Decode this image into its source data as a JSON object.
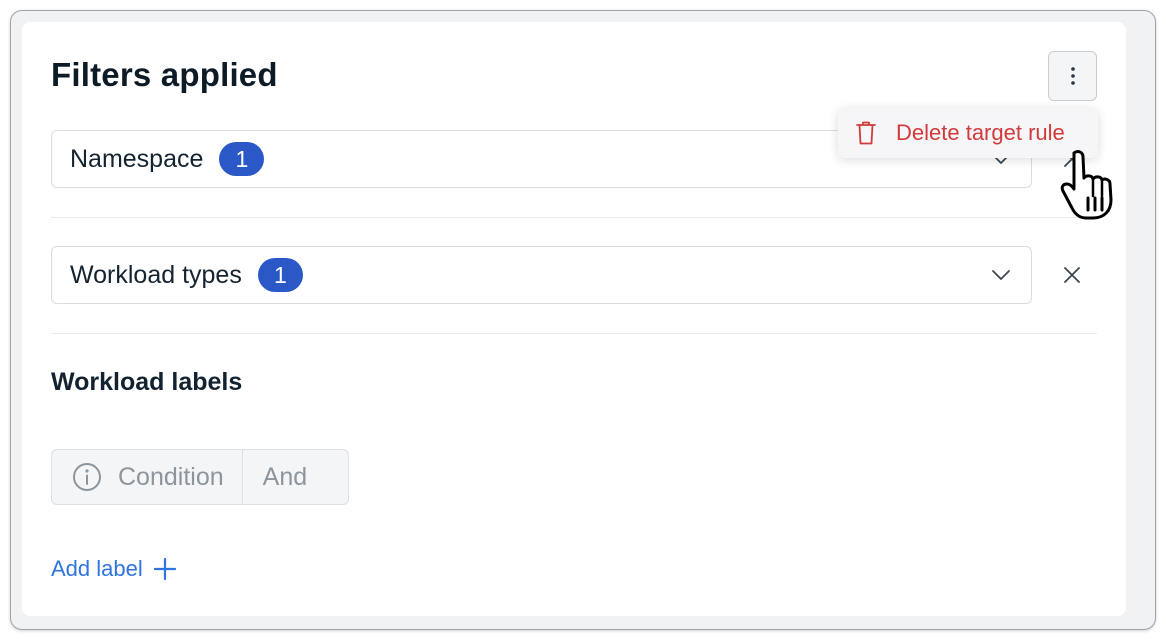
{
  "panel": {
    "title": "Filters applied",
    "more_button_icon": "more-vertical-icon"
  },
  "filters": [
    {
      "label": "Namespace",
      "count": "1"
    },
    {
      "label": "Workload types",
      "count": "1"
    }
  ],
  "workload_labels": {
    "heading": "Workload labels",
    "condition_label": "Condition",
    "operator_label": "And",
    "add_label_text": "Add label"
  },
  "context_menu": {
    "items": [
      {
        "label": "Delete target rule",
        "icon": "trash-icon",
        "color": "#d13b3b"
      }
    ]
  },
  "colors": {
    "badge": "#2a59c7",
    "link": "#2f74e0",
    "danger": "#d13b3b"
  }
}
